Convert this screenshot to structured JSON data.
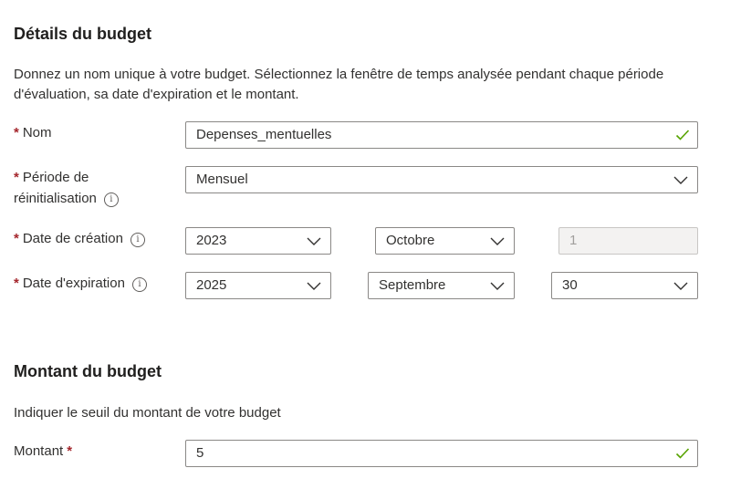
{
  "budget_details": {
    "title": "Détails du budget",
    "description": "Donnez un nom unique à votre budget. Sélectionnez la fenêtre de temps analysée pendant chaque période d'évaluation, sa date d'expiration et le montant.",
    "required_mark": "*",
    "info_glyph": "i",
    "name": {
      "label": "Nom",
      "value": "Depenses_mentuelles",
      "valid": true
    },
    "reset_period": {
      "label_line1": "Période de",
      "label_line2": "réinitialisation",
      "value": "Mensuel"
    },
    "creation_date": {
      "label": "Date de création",
      "year": "2023",
      "month": "Octobre",
      "day": "1",
      "day_disabled": true
    },
    "expiration_date": {
      "label": "Date d'expiration",
      "year": "2025",
      "month": "Septembre",
      "day": "30"
    }
  },
  "budget_amount": {
    "title": "Montant du budget",
    "description": "Indiquer le seuil du montant de votre budget",
    "amount": {
      "label": "Montant",
      "value": "5",
      "valid": true
    }
  },
  "colors": {
    "required": "#a4262c",
    "valid_check": "#57a300",
    "border": "#8a8886"
  },
  "icons": {
    "valid": "checkmark-icon",
    "dropdown": "chevron-down-icon",
    "info": "info-icon"
  }
}
